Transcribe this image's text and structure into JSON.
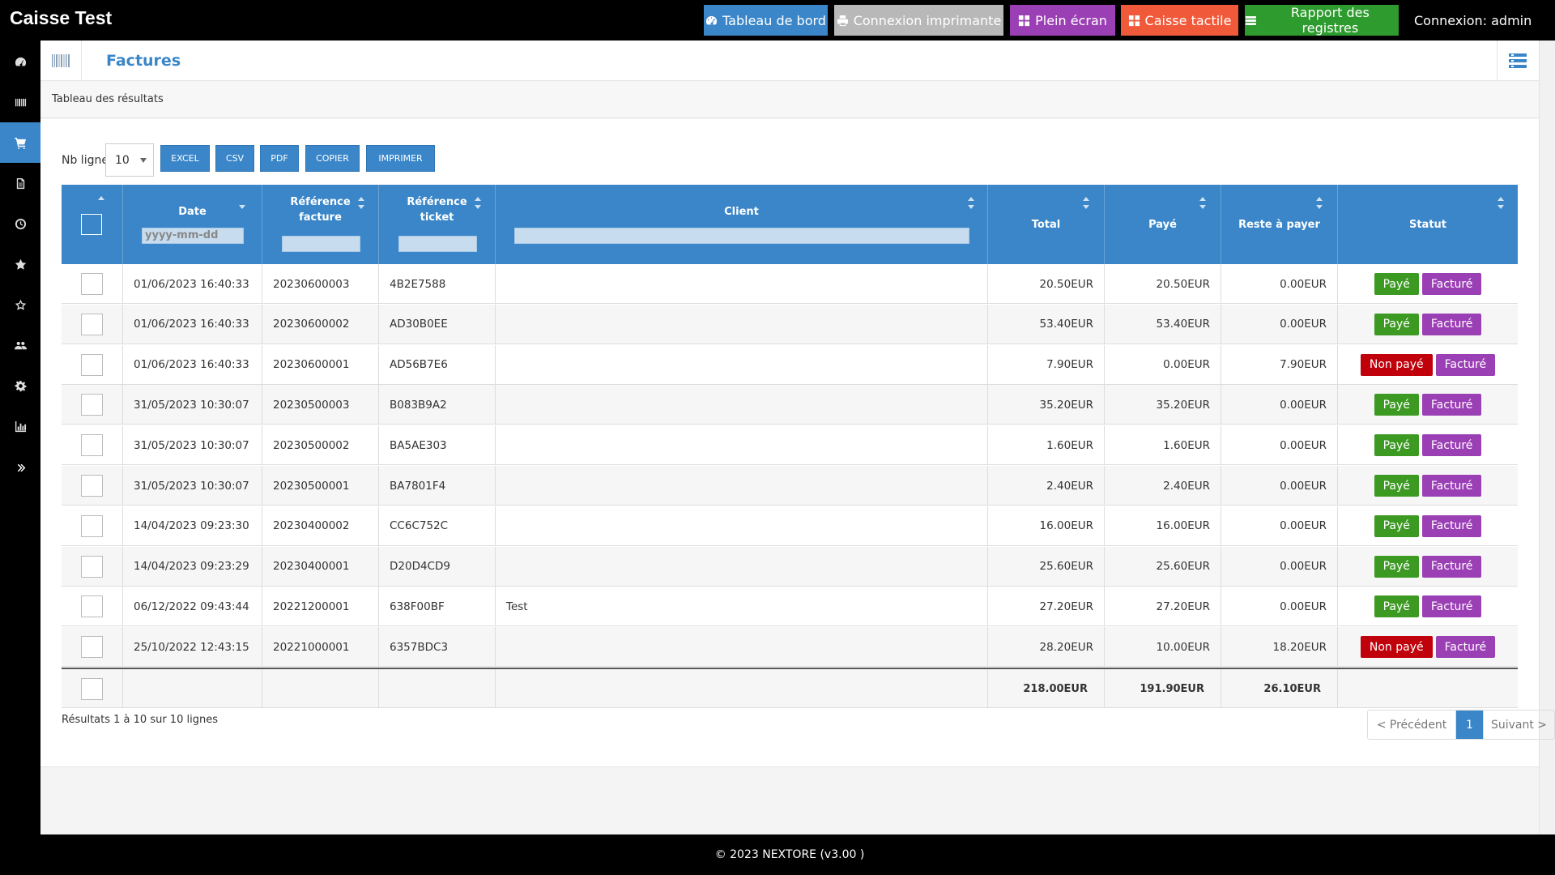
{
  "app": {
    "title": "Caisse Test"
  },
  "topbar": {
    "buttons": [
      {
        "label": "Tableau de bord",
        "color": "#3a86c8",
        "icon": "dashboard-icon"
      },
      {
        "label": "Connexion imprimante",
        "color": "#b8b8b8",
        "icon": "printer-icon"
      },
      {
        "label": "Plein écran",
        "color": "#9b3fb5",
        "icon": "grid-icon"
      },
      {
        "label": "Caisse tactile",
        "color": "#f05a3a",
        "icon": "grid-icon"
      },
      {
        "label": "Rapport des registres",
        "color": "#2e9b2e",
        "icon": "list-icon"
      }
    ],
    "login": "Connexion: admin"
  },
  "sidebar": {
    "items": [
      "dashboard-icon",
      "barcode-icon",
      "cart-icon",
      "document-icon",
      "clock-icon",
      "star-icon",
      "star-outline-icon",
      "users-icon",
      "gear-icon",
      "bar-chart-icon",
      "double-chevron-right-icon"
    ],
    "active_index": 2
  },
  "page": {
    "title": "Factures",
    "subtitle": "Tableau des résultats"
  },
  "toolbar": {
    "nb_label": "Nb ligne",
    "nb_value": "10",
    "exports": [
      "EXCEL",
      "CSV",
      "PDF",
      "COPIER",
      "IMPRIMER"
    ]
  },
  "table": {
    "columns": [
      {
        "label": "",
        "key": "check"
      },
      {
        "label": "Date",
        "key": "date",
        "filter_placeholder": "yyyy-mm-dd"
      },
      {
        "label": "Référence\nfacture",
        "key": "ref_facture",
        "filter_placeholder": ""
      },
      {
        "label": "Référence\nticket",
        "key": "ref_ticket",
        "filter_placeholder": ""
      },
      {
        "label": "Client",
        "key": "client",
        "filter_placeholder": ""
      },
      {
        "label": "Total",
        "key": "total"
      },
      {
        "label": "Payé",
        "key": "paye"
      },
      {
        "label": "Reste à payer",
        "key": "reste"
      },
      {
        "label": "Statut",
        "key": "statut"
      }
    ],
    "rows": [
      {
        "date": "01/06/2023 16:40:33",
        "ref_facture": "20230600003",
        "ref_ticket": "4B2E7588",
        "client": "",
        "total": "20.50EUR",
        "paye": "20.50EUR",
        "reste": "0.00EUR",
        "status": "Payé",
        "facture": "Facturé"
      },
      {
        "date": "01/06/2023 16:40:33",
        "ref_facture": "20230600002",
        "ref_ticket": "AD30B0EE",
        "client": "",
        "total": "53.40EUR",
        "paye": "53.40EUR",
        "reste": "0.00EUR",
        "status": "Payé",
        "facture": "Facturé"
      },
      {
        "date": "01/06/2023 16:40:33",
        "ref_facture": "20230600001",
        "ref_ticket": "AD56B7E6",
        "client": "",
        "total": "7.90EUR",
        "paye": "0.00EUR",
        "reste": "7.90EUR",
        "status": "Non payé",
        "facture": "Facturé"
      },
      {
        "date": "31/05/2023 10:30:07",
        "ref_facture": "20230500003",
        "ref_ticket": "B083B9A2",
        "client": "",
        "total": "35.20EUR",
        "paye": "35.20EUR",
        "reste": "0.00EUR",
        "status": "Payé",
        "facture": "Facturé"
      },
      {
        "date": "31/05/2023 10:30:07",
        "ref_facture": "20230500002",
        "ref_ticket": "BA5AE303",
        "client": "",
        "total": "1.60EUR",
        "paye": "1.60EUR",
        "reste": "0.00EUR",
        "status": "Payé",
        "facture": "Facturé"
      },
      {
        "date": "31/05/2023 10:30:07",
        "ref_facture": "20230500001",
        "ref_ticket": "BA7801F4",
        "client": "",
        "total": "2.40EUR",
        "paye": "2.40EUR",
        "reste": "0.00EUR",
        "status": "Payé",
        "facture": "Facturé"
      },
      {
        "date": "14/04/2023 09:23:30",
        "ref_facture": "20230400002",
        "ref_ticket": "CC6C752C",
        "client": "",
        "total": "16.00EUR",
        "paye": "16.00EUR",
        "reste": "0.00EUR",
        "status": "Payé",
        "facture": "Facturé"
      },
      {
        "date": "14/04/2023 09:23:29",
        "ref_facture": "20230400001",
        "ref_ticket": "D20D4CD9",
        "client": "",
        "total": "25.60EUR",
        "paye": "25.60EUR",
        "reste": "0.00EUR",
        "status": "Payé",
        "facture": "Facturé"
      },
      {
        "date": "06/12/2022 09:43:44",
        "ref_facture": "20221200001",
        "ref_ticket": "638F00BF",
        "client": "Test",
        "total": "27.20EUR",
        "paye": "27.20EUR",
        "reste": "0.00EUR",
        "status": "Payé",
        "facture": "Facturé"
      },
      {
        "date": "25/10/2022 12:43:15",
        "ref_facture": "20221000001",
        "ref_ticket": "6357BDC3",
        "client": "",
        "total": "28.20EUR",
        "paye": "10.00EUR",
        "reste": "18.20EUR",
        "status": "Non payé",
        "facture": "Facturé"
      }
    ],
    "totals": {
      "total": "218.00EUR",
      "paye": "191.90EUR",
      "reste": "26.10EUR"
    },
    "status_colors": {
      "Payé": "#3c9a22",
      "Non payé": "#c0000a",
      "Facturé": "#9b3fb5"
    }
  },
  "pagination": {
    "summary": "Résultats 1 à 10 sur 10 lignes",
    "prev": "< Précédent",
    "current": "1",
    "next": "Suivant >"
  },
  "footer": {
    "copyright": "© 2023 NEXTORE (v3.00 )"
  }
}
